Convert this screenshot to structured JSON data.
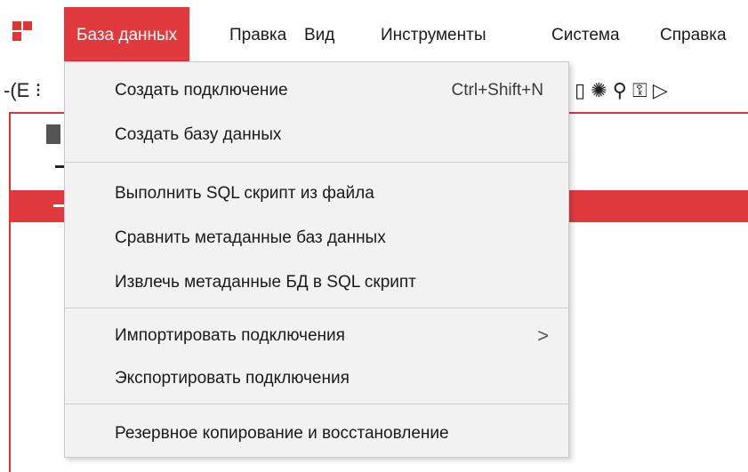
{
  "menubar": {
    "items": [
      {
        "label": "База данных",
        "active": true
      },
      {
        "label": "Правка"
      },
      {
        "label": "Вид"
      },
      {
        "label": "Инструменты"
      },
      {
        "label": "Система"
      },
      {
        "label": "Справка"
      }
    ]
  },
  "toolbar": {
    "left_glyph": "-(E ⁝",
    "right_glyph": "▯ ✺ ⚲ ⚿ ▷"
  },
  "dropdown": {
    "items": [
      {
        "label": "Создать подключение",
        "shortcut": "Ctrl+Shift+N"
      },
      {
        "label": "Создать базу данных"
      },
      {
        "label": "Выполнить SQL скрипт из файла"
      },
      {
        "label": "Сравнить метаданные баз данных"
      },
      {
        "label": "Извлечь метаданные БД в SQL скрипт"
      },
      {
        "label": "Импортировать подключения",
        "submenu_glyph": ">"
      },
      {
        "label": "Экспортировать подключения"
      },
      {
        "label": "Резервное копирование и восстановление"
      }
    ]
  },
  "colors": {
    "accent": "#e03a3e",
    "menu_bg": "#f2f2f2",
    "separator": "#cfcfcf"
  },
  "icons": [
    "app-logo-icon",
    "connect-icon",
    "submenu-arrow-icon"
  ]
}
